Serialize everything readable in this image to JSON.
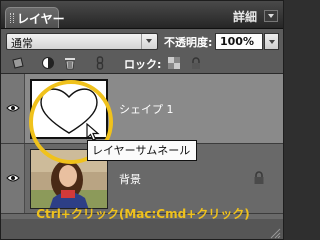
{
  "panel": {
    "tab_label": "レイヤー",
    "detail_label": "詳細"
  },
  "blend": {
    "mode": "通常",
    "opacity_label": "不透明度:",
    "opacity_value": "100%"
  },
  "tools": {
    "lock_label": "ロック:",
    "icons": [
      "new-layer-icon",
      "adjustment-layer-icon",
      "trash-icon",
      "link-icon",
      "lock-transparent-icon",
      "lock-all-icon"
    ]
  },
  "layers": [
    {
      "name": "シェイプ 1",
      "visible": true,
      "selected": true,
      "locked": false
    },
    {
      "name": "背景",
      "visible": true,
      "selected": false,
      "locked": true
    }
  ],
  "callout": {
    "tooltip": "レイヤーサムネール",
    "caption": "Ctrl+クリック(Mac:Cmd+クリック)"
  },
  "colors": {
    "highlight": "#f0c21c",
    "selected_row": "#8a8a8a"
  }
}
